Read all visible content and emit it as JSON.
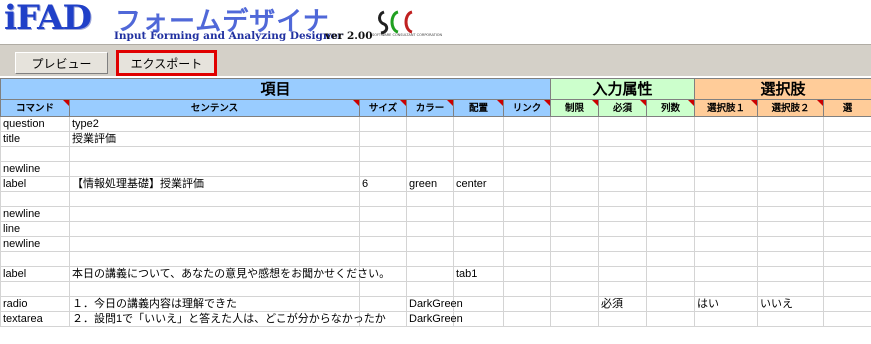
{
  "banner": {
    "logo": "iFAD",
    "title": "フォームデザイナ",
    "subtitle": "Input Forming and Analyzing Designer",
    "version": "ver 2.00",
    "company_text": "SOFTWARE CONSULTANT CORPORATION"
  },
  "toolbar": {
    "preview_label": "プレビュー",
    "export_label": "エクスポート"
  },
  "header": {
    "group_items": "項目",
    "group_input": "入力属性",
    "group_choices": "選択肢",
    "columns": [
      "コマンド",
      "センテンス",
      "サイズ",
      "カラー",
      "配置",
      "リンク",
      "制限",
      "必須",
      "列数",
      "選択肢１",
      "選択肢２",
      "選"
    ]
  },
  "rows": [
    {
      "command": "question",
      "sentence": "type2",
      "size": "",
      "color": "",
      "align": "",
      "link": "",
      "limit": "",
      "required": "",
      "cols": "",
      "choice1": "",
      "choice2": ""
    },
    {
      "command": "title",
      "sentence": "授業評価",
      "size": "",
      "color": "",
      "align": "",
      "link": "",
      "limit": "",
      "required": "",
      "cols": "",
      "choice1": "",
      "choice2": ""
    },
    {
      "command": "",
      "sentence": "",
      "size": "",
      "color": "",
      "align": "",
      "link": "",
      "limit": "",
      "required": "",
      "cols": "",
      "choice1": "",
      "choice2": ""
    },
    {
      "command": "newline",
      "sentence": "",
      "size": "",
      "color": "",
      "align": "",
      "link": "",
      "limit": "",
      "required": "",
      "cols": "",
      "choice1": "",
      "choice2": ""
    },
    {
      "command": "label",
      "sentence": "【情報処理基礎】授業評価",
      "size": "6",
      "color": "green",
      "align": "center",
      "link": "",
      "limit": "",
      "required": "",
      "cols": "",
      "choice1": "",
      "choice2": ""
    },
    {
      "command": "",
      "sentence": "",
      "size": "",
      "color": "",
      "align": "",
      "link": "",
      "limit": "",
      "required": "",
      "cols": "",
      "choice1": "",
      "choice2": ""
    },
    {
      "command": "newline",
      "sentence": "",
      "size": "",
      "color": "",
      "align": "",
      "link": "",
      "limit": "",
      "required": "",
      "cols": "",
      "choice1": "",
      "choice2": ""
    },
    {
      "command": "line",
      "sentence": "",
      "size": "",
      "color": "",
      "align": "",
      "link": "",
      "limit": "",
      "required": "",
      "cols": "",
      "choice1": "",
      "choice2": ""
    },
    {
      "command": "newline",
      "sentence": "",
      "size": "",
      "color": "",
      "align": "",
      "link": "",
      "limit": "",
      "required": "",
      "cols": "",
      "choice1": "",
      "choice2": ""
    },
    {
      "command": "",
      "sentence": "",
      "size": "",
      "color": "",
      "align": "",
      "link": "",
      "limit": "",
      "required": "",
      "cols": "",
      "choice1": "",
      "choice2": ""
    },
    {
      "command": "label",
      "sentence": "本日の講義について、あなたの意見や感想をお聞かせください。",
      "size": "",
      "color": "",
      "align": "tab1",
      "link": "",
      "limit": "",
      "required": "",
      "cols": "",
      "choice1": "",
      "choice2": ""
    },
    {
      "command": "",
      "sentence": "",
      "size": "",
      "color": "",
      "align": "",
      "link": "",
      "limit": "",
      "required": "",
      "cols": "",
      "choice1": "",
      "choice2": ""
    },
    {
      "command": "radio",
      "sentence": "１．今日の講義内容は理解できた",
      "size": "",
      "color": "DarkGreen",
      "align": "",
      "link": "",
      "limit": "",
      "required": "必須",
      "cols": "",
      "choice1": "はい",
      "choice2": "いいえ"
    },
    {
      "command": "textarea",
      "sentence": "２．設問1で「いいえ」と答えた人は、どこが分からなかったか",
      "size": "",
      "color": "DarkGreen",
      "align": "",
      "link": "",
      "limit": "",
      "required": "",
      "cols": "",
      "choice1": "",
      "choice2": ""
    }
  ]
}
